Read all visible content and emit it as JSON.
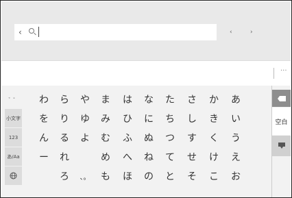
{
  "search": {
    "back": "‹",
    "icon": "search-icon"
  },
  "nav": {
    "left": "‹",
    "right": "›"
  },
  "candidates": {
    "more": "···"
  },
  "side": [
    "゛゜",
    "小文字",
    "123",
    "あ/Aa",
    "globe-icon"
  ],
  "right": {
    "backspace": "backspace-icon",
    "space": "空白",
    "enter": "enter-icon"
  },
  "rows": [
    [
      "わ",
      "ら",
      "や",
      "ま",
      "は",
      "な",
      "た",
      "さ",
      "か",
      "あ"
    ],
    [
      "を",
      "り",
      "ゆ",
      "み",
      "ひ",
      "に",
      "ち",
      "し",
      "き",
      "い"
    ],
    [
      "ん",
      "る",
      "よ",
      "む",
      "ふ",
      "ぬ",
      "つ",
      "す",
      "く",
      "う"
    ],
    [
      "ー",
      "れ",
      "",
      "め",
      "へ",
      "ね",
      "て",
      "せ",
      "け",
      "え"
    ],
    [
      "",
      "ろ",
      "、。",
      "も",
      "ほ",
      "の",
      "と",
      "そ",
      "こ",
      "お"
    ]
  ]
}
